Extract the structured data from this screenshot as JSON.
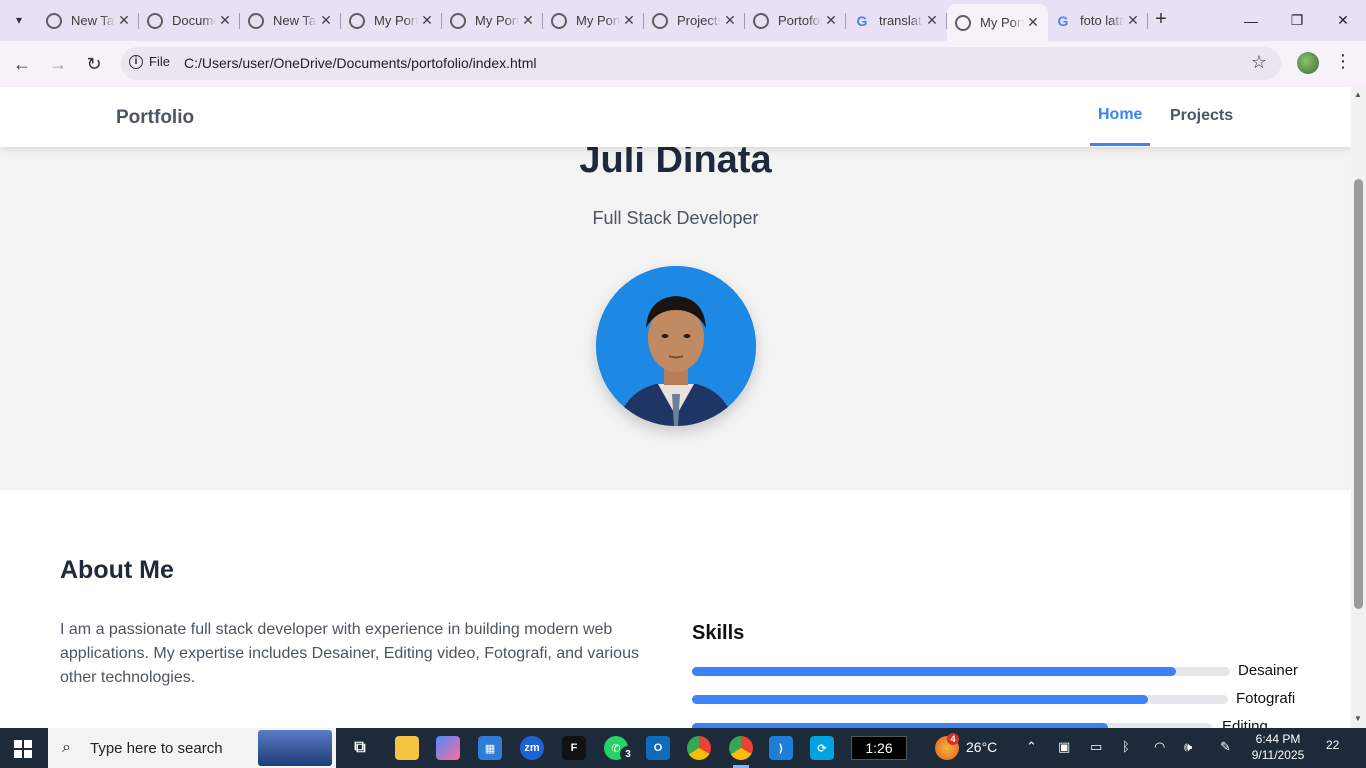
{
  "browser": {
    "tabs": [
      {
        "title": "New Tab",
        "favicon": "chrome-icon",
        "active": false
      },
      {
        "title": "Document",
        "favicon": "globe-icon",
        "active": false
      },
      {
        "title": "New Tab",
        "favicon": "chrome-icon",
        "active": false
      },
      {
        "title": "My Portfolio",
        "favicon": "globe-icon",
        "active": false
      },
      {
        "title": "My Portfolio",
        "favicon": "globe-icon",
        "active": false
      },
      {
        "title": "My Portfolio",
        "favicon": "globe-icon",
        "active": false
      },
      {
        "title": "Projects",
        "favicon": "globe-icon",
        "active": false
      },
      {
        "title": "Portofolio",
        "favicon": "globe-icon",
        "active": false
      },
      {
        "title": "translate",
        "favicon": "google-icon",
        "active": false
      },
      {
        "title": "My Portfolio",
        "favicon": "globe-icon",
        "active": true
      },
      {
        "title": "foto latar",
        "favicon": "google-icon",
        "active": false
      }
    ],
    "address_chip": "File",
    "url": "C:/Users/user/OneDrive/Documents/portofolio/index.html"
  },
  "page": {
    "navbar": {
      "brand": "Portfolio",
      "links": [
        "Home",
        "Projects"
      ],
      "active_link": "Home"
    },
    "hero": {
      "name": "Juli Dinata",
      "role": "Full Stack Developer"
    },
    "about": {
      "title": "About Me",
      "text": "I am a passionate full stack developer with experience in building modern web applications. My expertise includes Desainer, Editing video, Fotografi, and various other technologies."
    },
    "skills": {
      "title": "Skills",
      "items": [
        {
          "label": "Desainer",
          "level": 0.9
        },
        {
          "label": "Fotografi",
          "level": 0.85
        },
        {
          "label": "Editing",
          "level": 0.8
        }
      ]
    }
  },
  "taskbar": {
    "search_placeholder": "Type here to search",
    "timer": "1:26",
    "weather_badge": "4",
    "temperature": "26°C",
    "time": "6:44 PM",
    "date": "9/11/2025",
    "notification_count": "22",
    "whatsapp_badge": "3"
  },
  "colors": {
    "accent": "#3b82f6",
    "hero_bg": "#f3f3f3",
    "avatar_bg": "#1e88e5"
  }
}
